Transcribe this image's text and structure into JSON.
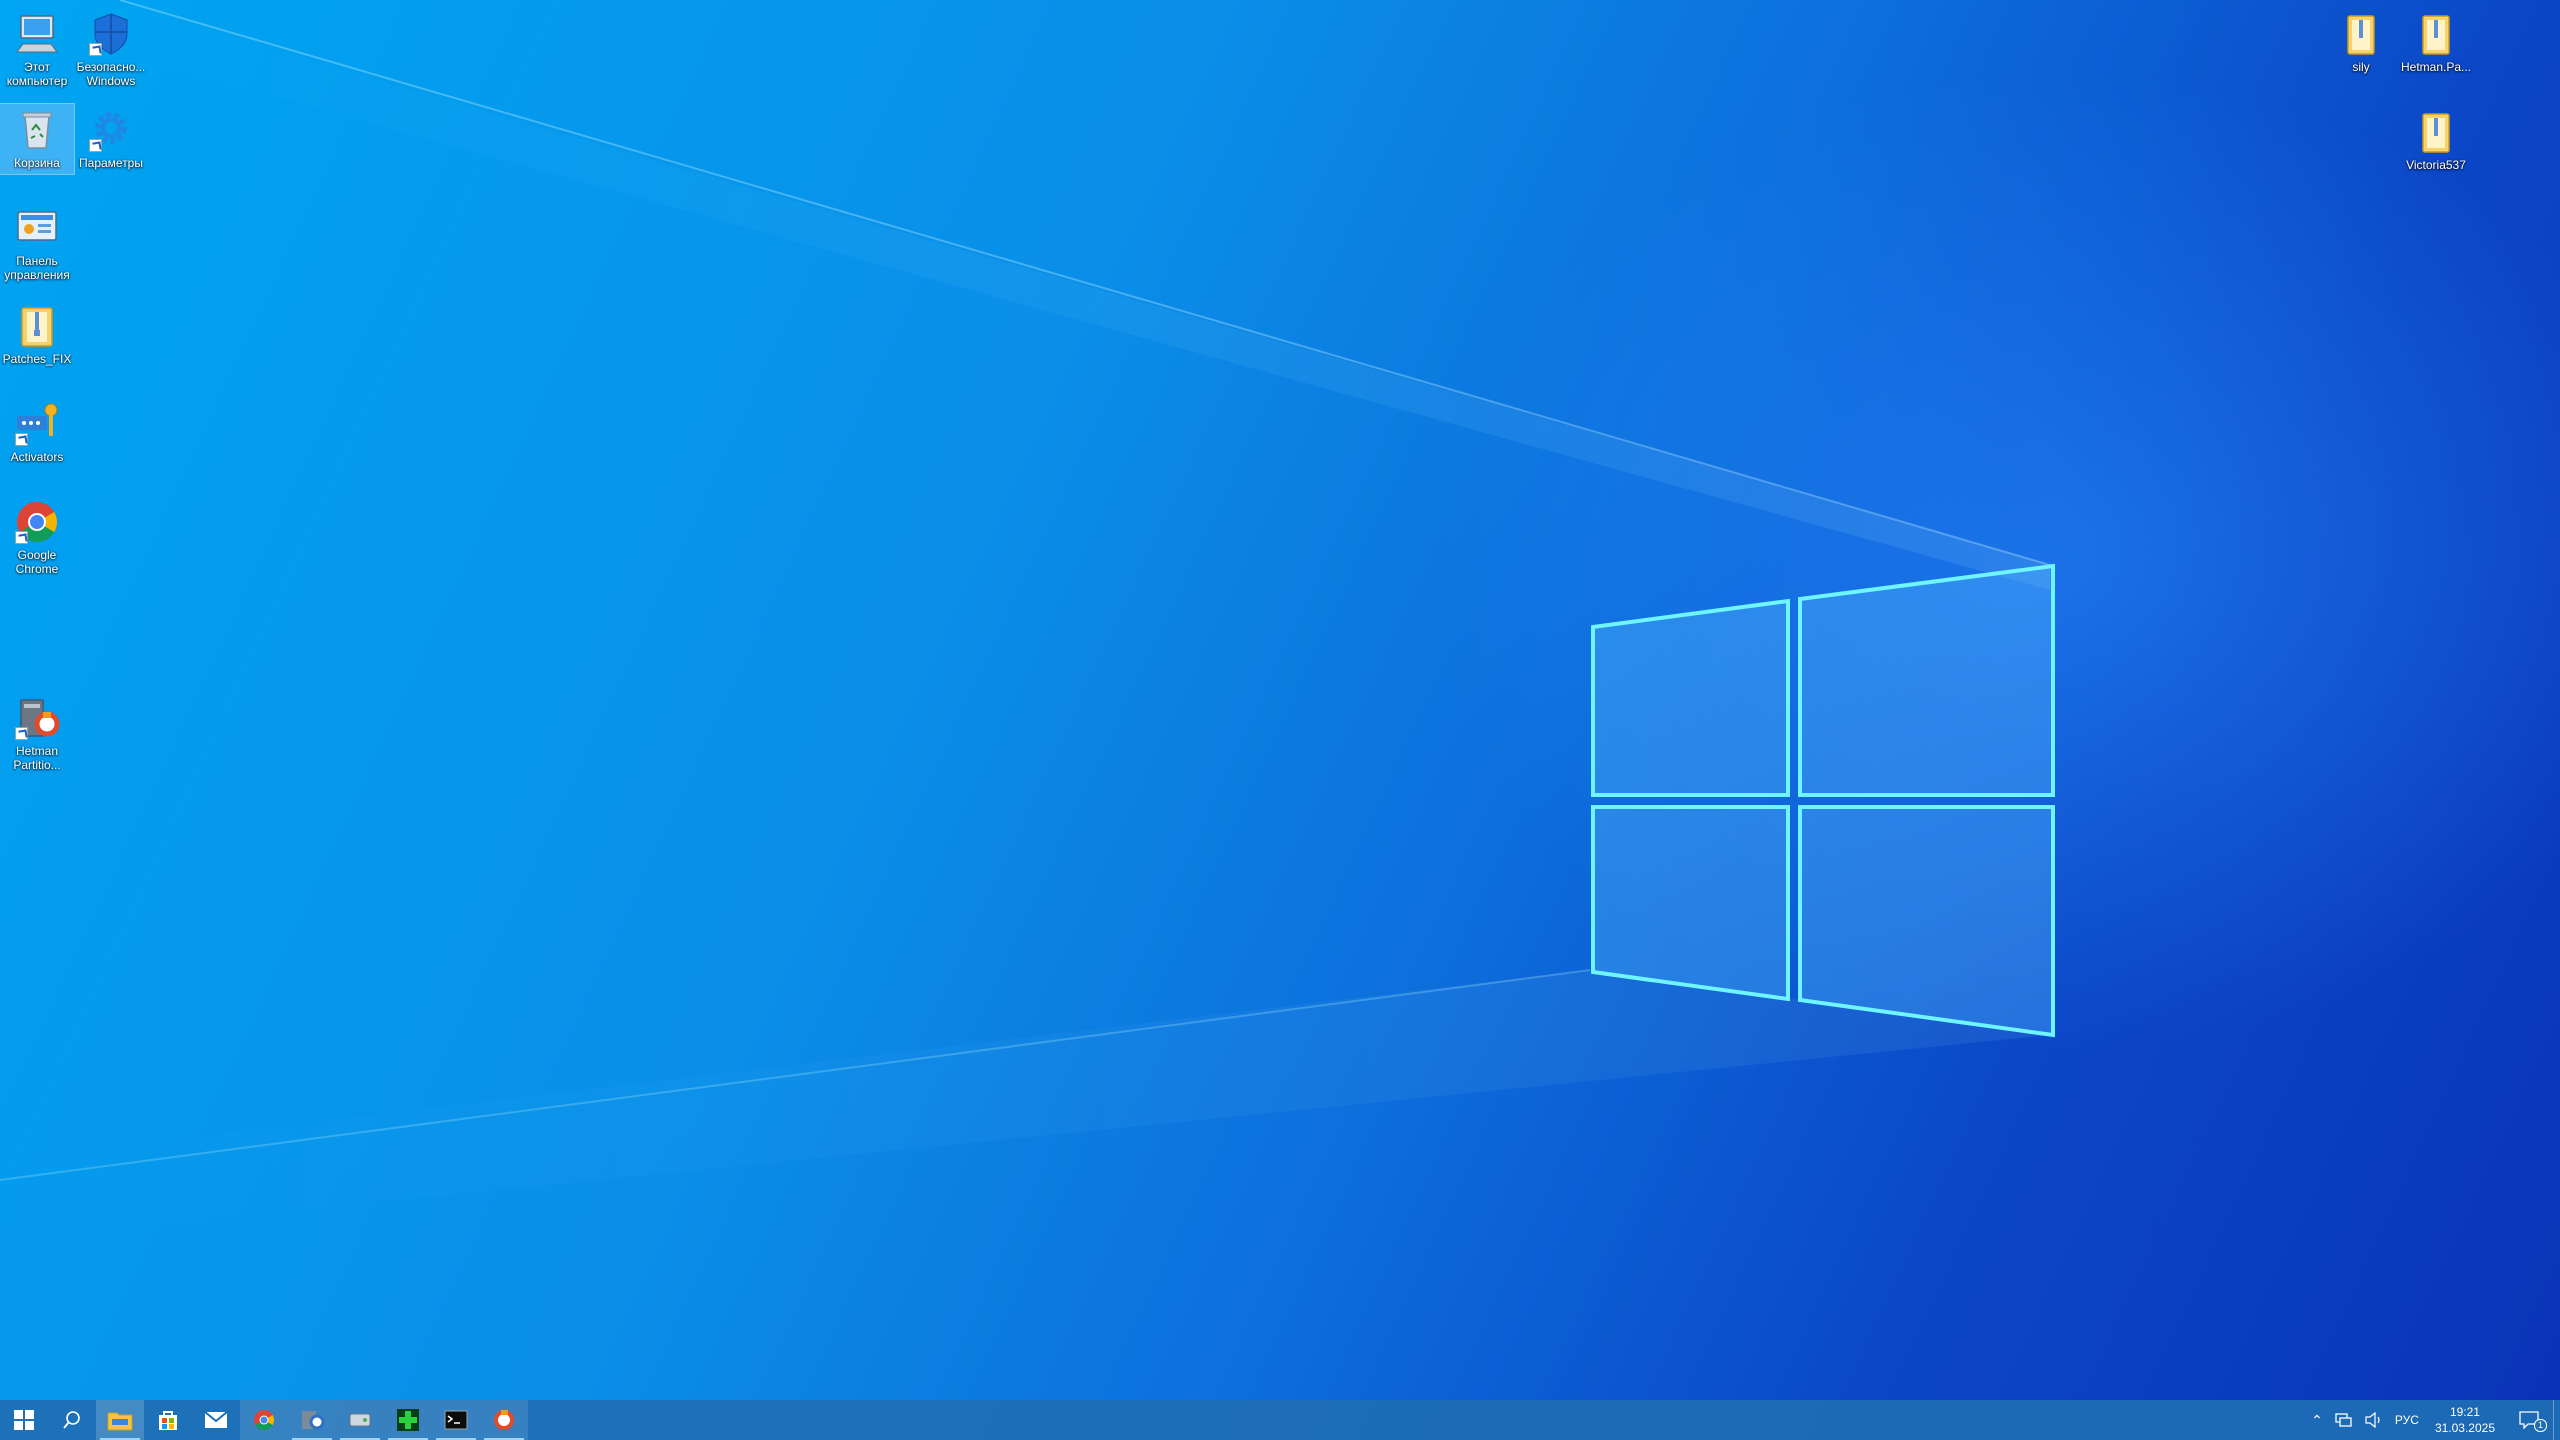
{
  "desktop_icons": {
    "computer": "Этот компьютер",
    "security": "Безопасно... Windows",
    "recycle": "Корзина",
    "settings": "Параметры",
    "control_panel": "Панель управления",
    "patches": "Patches_FIX",
    "activators": "Activators",
    "chrome": "Google Chrome",
    "hetman_partition": "Hetman Partitio...",
    "sily": "sily",
    "hetman_folder": "Hetman.Pa...",
    "victoria": "Victoria537"
  },
  "taskbar": {
    "tray_language": "РУС",
    "clock_time": "19:21",
    "clock_date": "31.03.2025",
    "notification_count": "1"
  },
  "colors": {
    "accent": "#0b6fd8",
    "taskbar": "#1e6eb4"
  }
}
